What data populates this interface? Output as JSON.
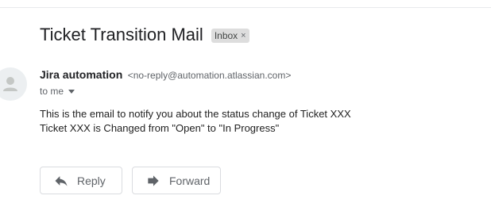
{
  "email": {
    "subject": "Ticket Transition Mail",
    "label": {
      "text": "Inbox",
      "remove_glyph": "×"
    },
    "sender": {
      "name": "Jira automation",
      "email": "<no-reply@automation.atlassian.com>",
      "avatar_icon": "person-icon"
    },
    "recipient": {
      "text": "to me",
      "caret_icon": "caret-down-icon"
    },
    "body": {
      "line1": "This is the email to notify you about the status change of Ticket XXX",
      "line2": "Ticket XXX is Changed from \"Open\" to \"In Progress\""
    }
  },
  "actions": {
    "reply": {
      "label": "Reply",
      "icon": "reply-icon"
    },
    "forward": {
      "label": "Forward",
      "icon": "forward-icon"
    }
  },
  "colors": {
    "text_primary": "#202124",
    "text_secondary": "#5f6368",
    "chip_bg": "#dddddd",
    "border": "#dadce0"
  }
}
